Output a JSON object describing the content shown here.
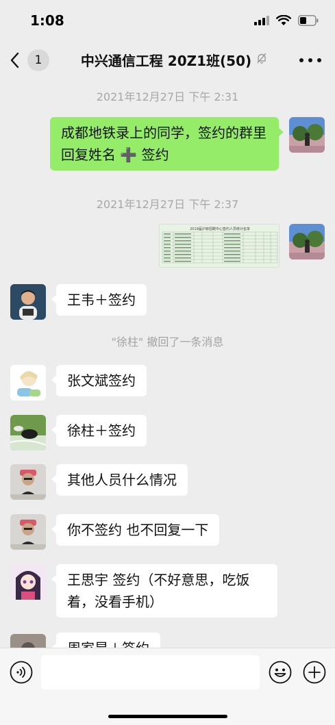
{
  "status_bar": {
    "time": "1:08"
  },
  "nav": {
    "unread_count": "1",
    "title": "中兴通信工程 20Z1班(50)"
  },
  "chat": {
    "timestamps": [
      "2021年12月27日 下午 2:31",
      "2021年12月27日 下午 2:37"
    ],
    "messages": [
      {
        "from": "me",
        "text": "成都地铁录上的同学，签约的群里回复姓名 ➕ 签约"
      },
      {
        "from": "me",
        "type": "image",
        "image_title": "2019届沪转招聘中心签约人员统计名单"
      },
      {
        "from": "other",
        "text": "王韦＋签约"
      },
      {
        "type": "system",
        "text": "\"徐柱\" 撤回了一条消息"
      },
      {
        "from": "other",
        "text": "张文斌签约"
      },
      {
        "from": "other",
        "text": "徐柱＋签约"
      },
      {
        "from": "other",
        "text": "其他人员什么情况"
      },
      {
        "from": "other",
        "text": "你不签约 也不回复一下"
      },
      {
        "from": "other",
        "text": "王思宇  签约（不好意思，吃饭着，没看手机）"
      },
      {
        "from": "other",
        "text": "周家昂＋签约"
      }
    ]
  },
  "input_bar": {
    "placeholder": ""
  },
  "icons": {
    "back": "chevron-left-icon",
    "mute": "bell-slash-icon",
    "more": "more-dots-icon",
    "voice": "voice-icon",
    "emoji": "emoji-icon",
    "plus": "plus-icon"
  },
  "colors": {
    "background": "#ededed",
    "my_bubble": "#95ec69",
    "their_bubble": "#ffffff"
  }
}
